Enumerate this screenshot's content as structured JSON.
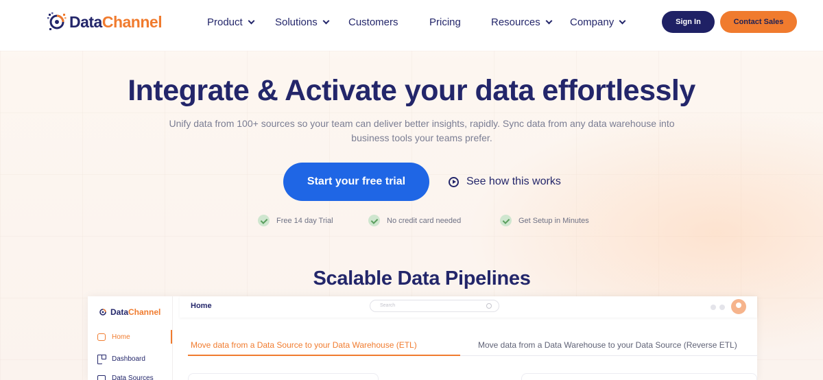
{
  "nav": {
    "logo_part1": "Data",
    "logo_part2": "Channel",
    "items": [
      {
        "label": "Product",
        "dropdown": true
      },
      {
        "label": "Solutions",
        "dropdown": true
      },
      {
        "label": "Customers",
        "dropdown": false
      },
      {
        "label": "Pricing",
        "dropdown": false
      },
      {
        "label": "Resources",
        "dropdown": true
      },
      {
        "label": "Company",
        "dropdown": true
      }
    ],
    "signin_label": "Sign In",
    "contact_label": "Contact Sales"
  },
  "hero": {
    "title": "Integrate & Activate your data effortlessly",
    "subtitle": "Unify data from 100+ sources so your team can deliver better insights, rapidly. Sync data from any data warehouse into business tools your teams prefer.",
    "cta_primary": "Start your free trial",
    "cta_secondary": "See how this works",
    "features": [
      "Free 14 day Trial",
      "No credit card needed",
      "Get Setup in Minutes"
    ]
  },
  "section": {
    "title": "Scalable Data Pipelines"
  },
  "preview": {
    "logo_part1": "Data",
    "logo_part2": "Channel",
    "nav": [
      "Home",
      "Dashboard",
      "Data Sources"
    ],
    "page_title": "Home",
    "search_placeholder": "Search",
    "tabs": [
      "Move data from a Data Source to your Data Warehouse (ETL)",
      "Move data from a Data Warehouse to your Data Source (Reverse ETL)"
    ]
  },
  "colors": {
    "brand_navy": "#23266a",
    "brand_orange": "#f07b2e",
    "primary_blue": "#1f66e5"
  }
}
